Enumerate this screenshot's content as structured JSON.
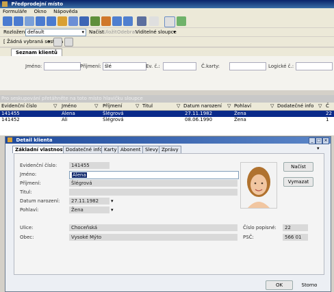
{
  "app": {
    "title": "Předprodejní místo"
  },
  "menu": [
    "Formuláře",
    "Okno",
    "Nápověda"
  ],
  "row2": {
    "layout_label": "Rozložení:",
    "layout_value": "default",
    "load": "Načíst",
    "save": "Uložit",
    "remove": "Odebrat",
    "visible_columns": "Viditelné sloupce"
  },
  "row3": {
    "report_value": "[ Žádná vybraná sestava ]"
  },
  "list_tab": "Seznam klientů",
  "filter": {
    "first_name_label": "Jméno:",
    "last_name_label": "Příjmení:",
    "last_name_value": "šlé",
    "ev_label": "Ev. č.:",
    "card_label": "Č.karty:",
    "logical_label": "Logické č.:",
    "group_hint": "Pro seskupování přetáhněte na toto místo hlavičku sloupce"
  },
  "grid": {
    "columns": [
      "Evidenční číslo",
      "Jméno",
      "Příjmení",
      "Titul",
      "Datum narození",
      "Pohlaví",
      "Dodatečné info",
      "Č"
    ],
    "rows": [
      {
        "id": "141455",
        "first": "Alena",
        "last": "Šlégrová",
        "title": "",
        "dob": "27.11.1982",
        "sex": "Žena",
        "info": "",
        "c": "22"
      },
      {
        "id": "141452",
        "first": "Ali",
        "last": "Šlégrová",
        "title": "",
        "dob": "08.06.1990",
        "sex": "Žena",
        "info": "",
        "c": "1"
      }
    ]
  },
  "detail": {
    "title": "Detail klienta",
    "tabs": [
      "Základní vlastnosti",
      "Dodatečné info",
      "Karty",
      "Abonent",
      "Slevy",
      "Zprávy"
    ],
    "labels": {
      "ev": "Evidenční číslo:",
      "first": "Jméno:",
      "last": "Příjmení:",
      "title": "Titul:",
      "dob": "Datum narození:",
      "sex": "Pohlaví:",
      "street": "Ulice:",
      "city": "Obec:",
      "house": "Číslo popisné:",
      "zip": "PSČ:"
    },
    "values": {
      "ev": "141455",
      "first": "Alena",
      "last": "Šlégrová",
      "title": "",
      "dob": "27.11.1982",
      "sex": "Žena",
      "street": "Choceňská",
      "city": "Vysoké Mýto",
      "house": "22",
      "zip": "566 01"
    },
    "buttons": {
      "load": "Načíst",
      "clear": "Vymazat",
      "ok": "OK",
      "cancel": "Storno"
    }
  }
}
